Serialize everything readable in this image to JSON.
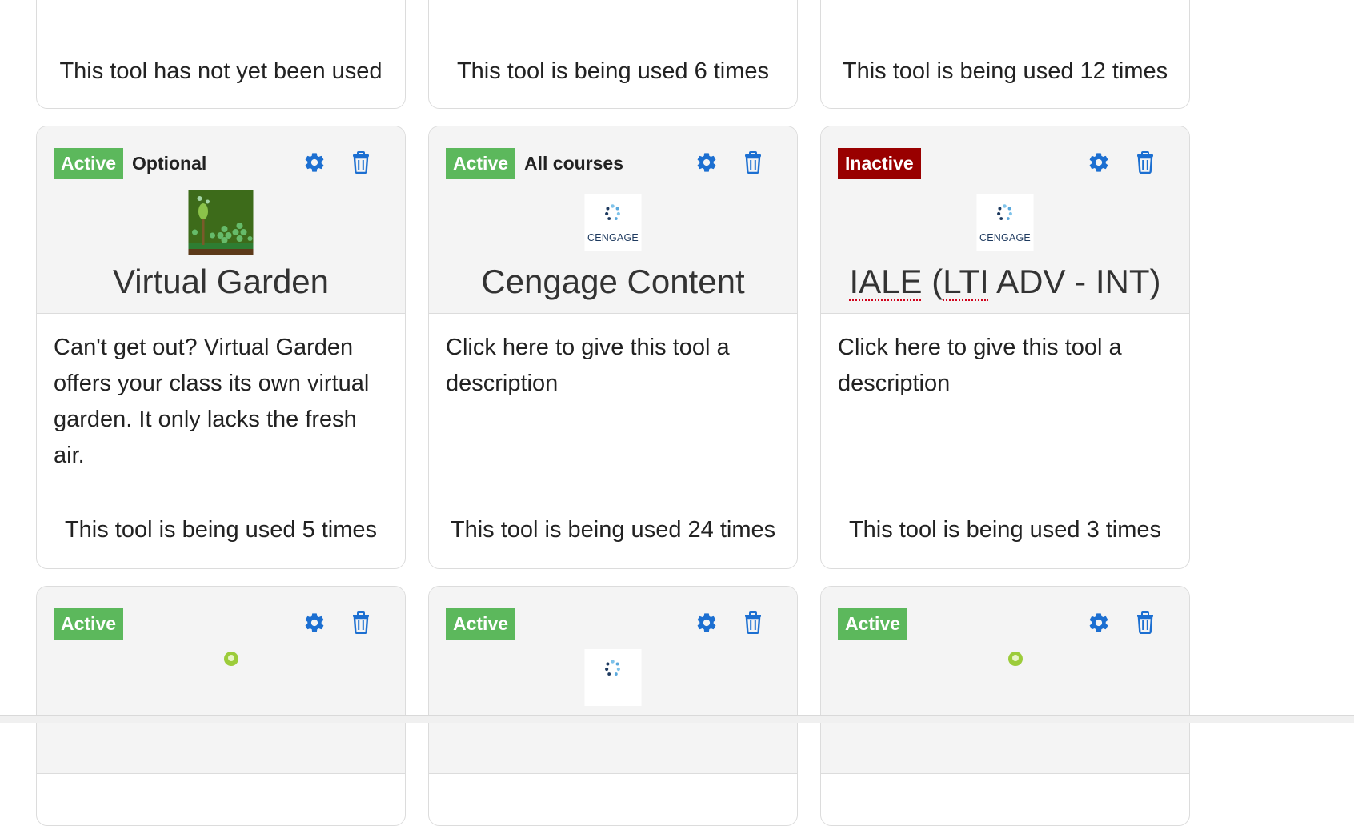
{
  "colors": {
    "active": "#5cb85c",
    "inactive": "#990000",
    "icon_blue": "#1c6fd1"
  },
  "icons": {
    "settings": "gear-icon",
    "delete": "trash-icon"
  },
  "top_row": [
    {
      "usage": "This tool has not yet been used"
    },
    {
      "usage": "This tool is being used 6 times"
    },
    {
      "usage": "This tool is being used 12 times"
    }
  ],
  "middle_row": [
    {
      "status": "Active",
      "scope": "Optional",
      "logo": "virtual-garden-logo",
      "title": "Virtual Garden",
      "description": "Can't get out? Virtual Garden offers your class its own virtual garden. It only lacks the fresh air.",
      "usage": "This tool is being used 5 times"
    },
    {
      "status": "Active",
      "scope": "All courses",
      "logo": "cengage-logo",
      "logo_text": "CENGAGE",
      "title": "Cengage Content",
      "description": "Click here to give this tool a description",
      "usage": "This tool is being used 24 times"
    },
    {
      "status": "Inactive",
      "logo": "cengage-logo",
      "logo_text": "CENGAGE",
      "title_parts": [
        "IALE",
        " (",
        "LTI",
        " ADV - INT)"
      ],
      "description": "Click here to give this tool a description",
      "usage": "This tool is being used 3 times"
    }
  ],
  "bottom_row": [
    {
      "status": "Active"
    },
    {
      "status": "Active"
    },
    {
      "status": "Active"
    }
  ]
}
